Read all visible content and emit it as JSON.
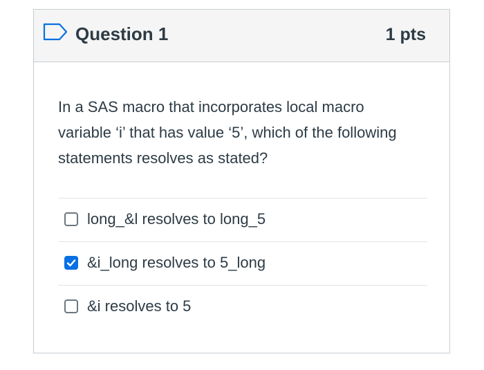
{
  "question": {
    "title": "Question 1",
    "points": "1 pts",
    "text": "In a SAS macro that incorporates local macro variable ‘i’ that has value ‘5’, which of the following statements resolves as stated?",
    "flag_icon": "bookmark-flag-icon"
  },
  "answers": [
    {
      "label": "long_&l resolves to long_5",
      "checked": false
    },
    {
      "label": "&i_long resolves to 5_long",
      "checked": true
    },
    {
      "label": "&i resolves to 5",
      "checked": false
    }
  ],
  "colors": {
    "checkbox_checked": "#0770e3",
    "text": "#2d3b45",
    "header_bg": "#f5f5f5",
    "border": "#c7cdd1"
  }
}
